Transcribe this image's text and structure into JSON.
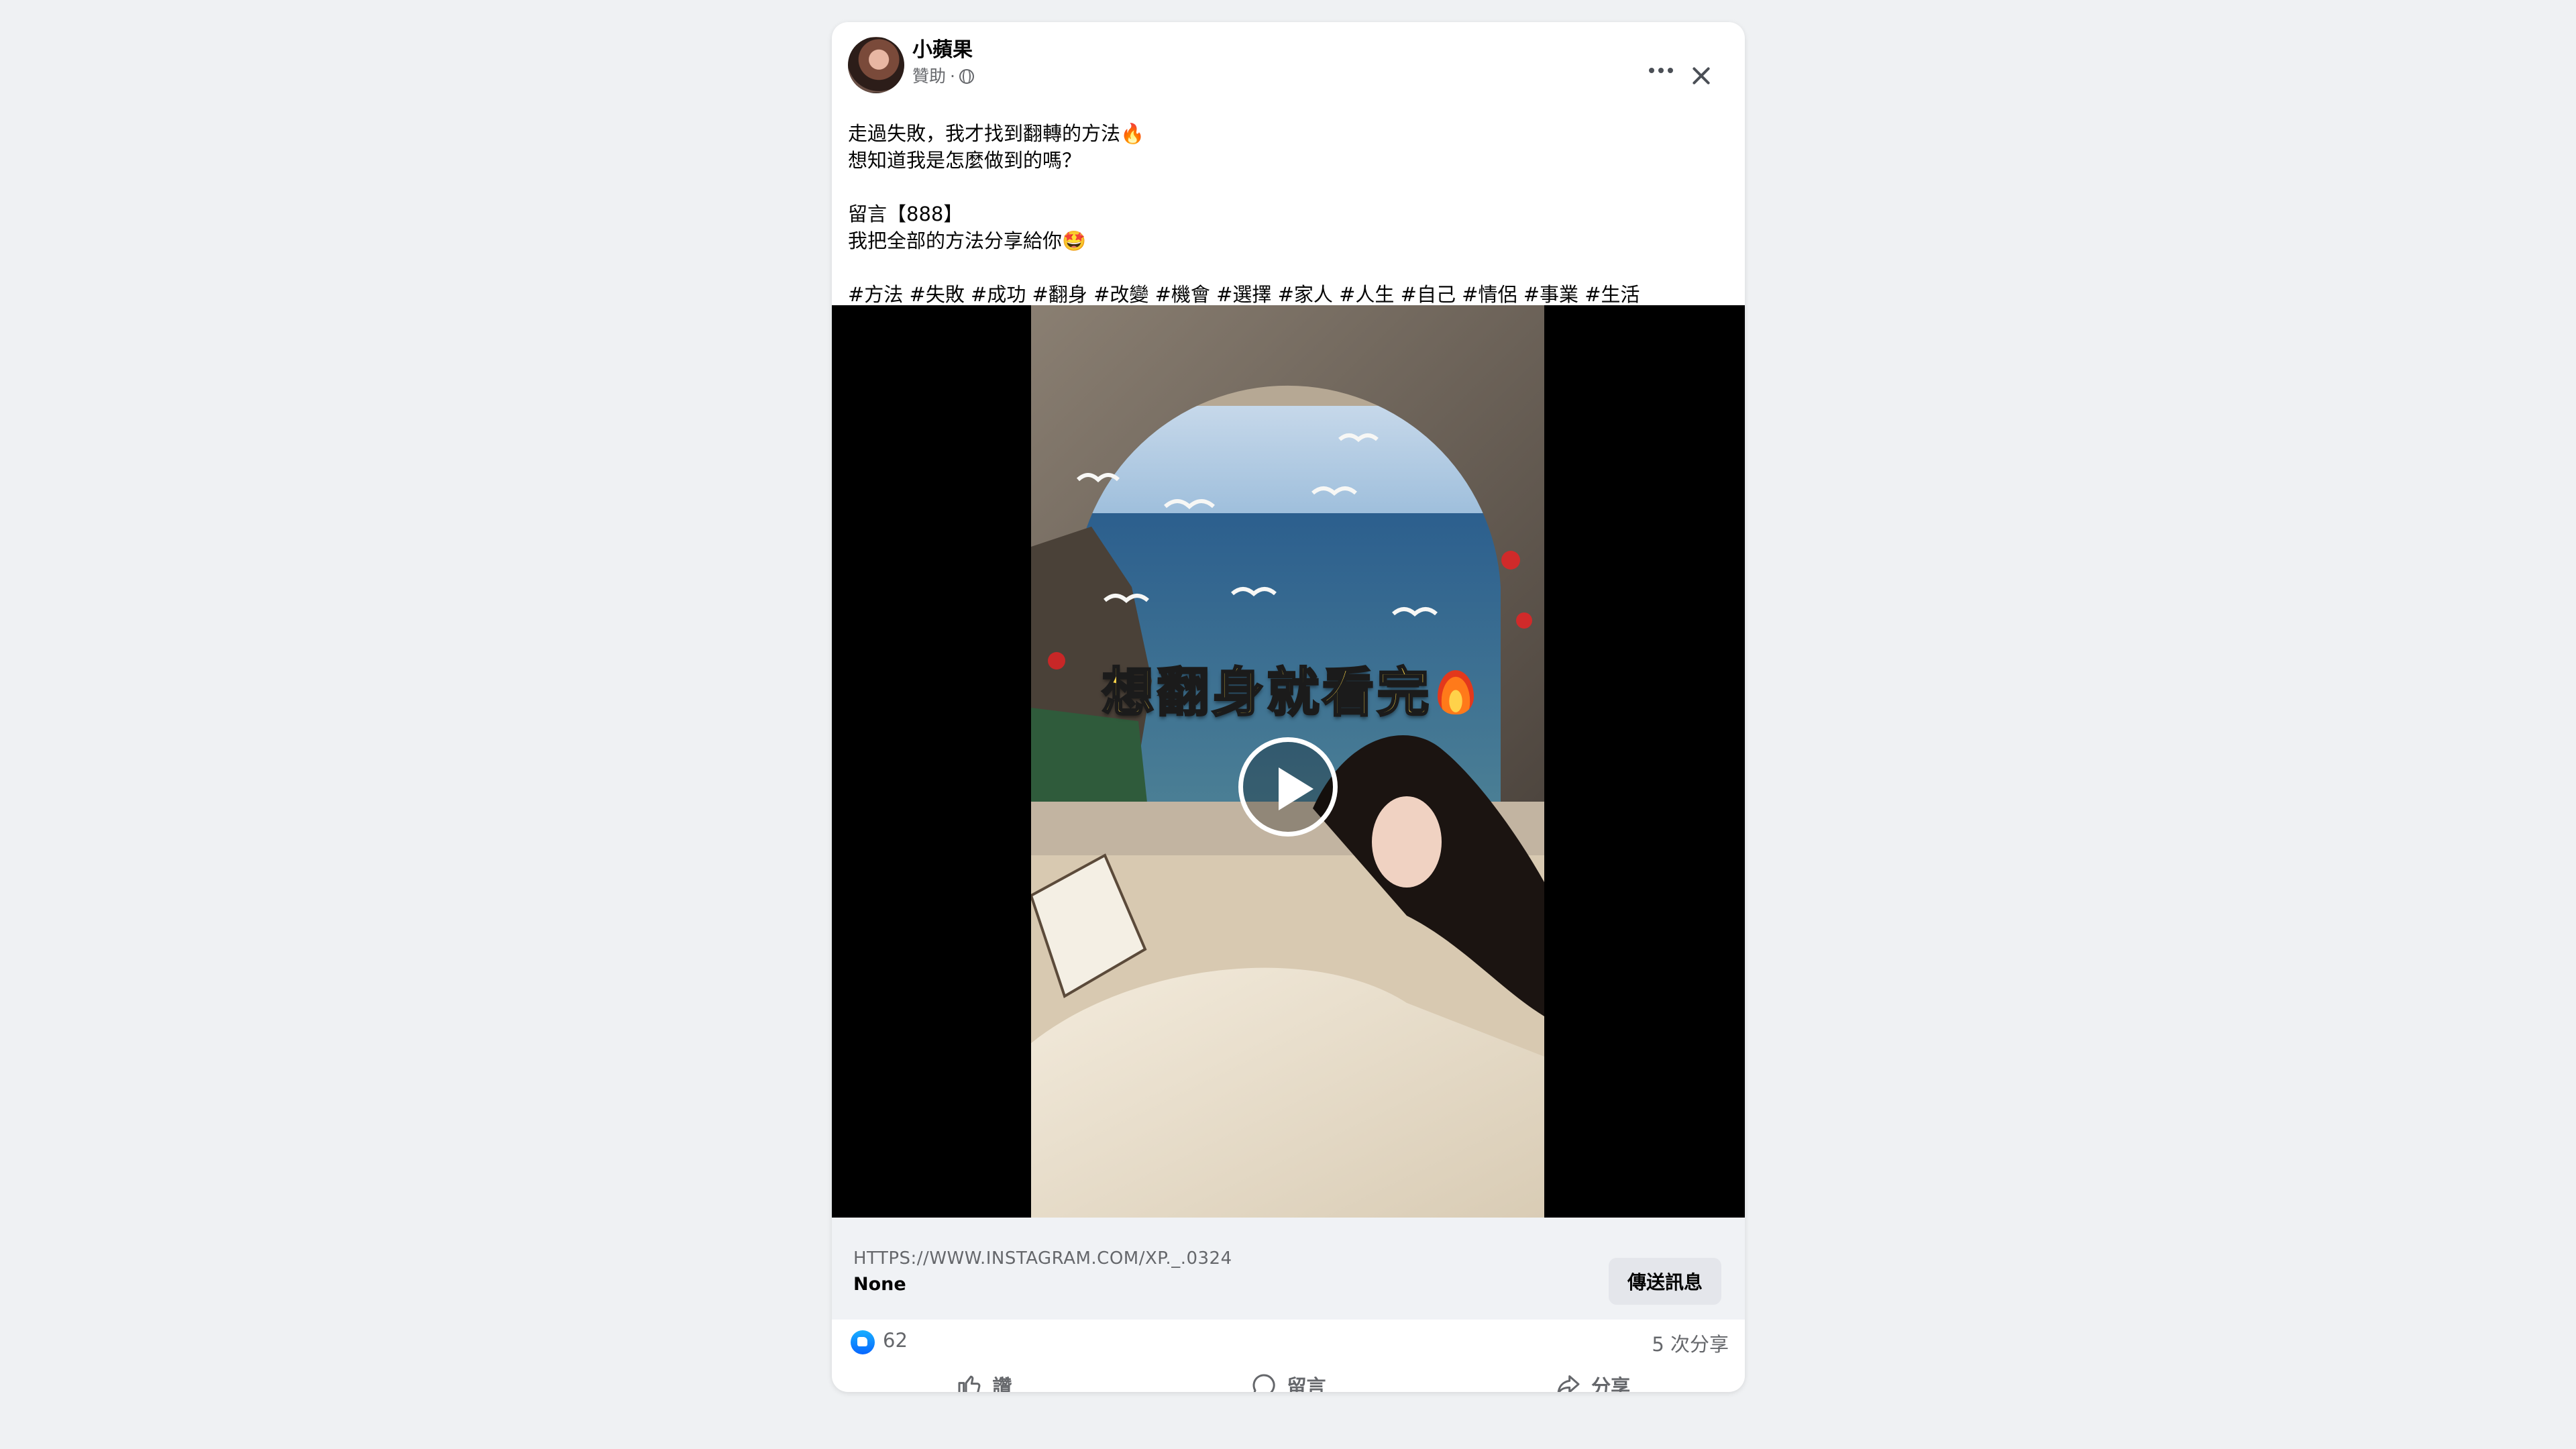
{
  "post": {
    "page_name": "小蘋果",
    "sponsored_label": "贊助",
    "meta_separator": "·",
    "text_lines": [
      "走過失敗，我才找到翻轉的方法🔥",
      "想知道我是怎麼做到的嗎？",
      "",
      "留言【888】",
      "我把全部的方法分享給你🤩",
      "",
      "#方法 #失敗 #成功 #翻身 #改變 #機會 #選擇 #家人 #人生 #自己 #情侶 #事業 #生活"
    ]
  },
  "video": {
    "overlay_text": "想翻身就看完"
  },
  "link": {
    "url": "HTTPS://WWW.INSTAGRAM.COM/XP._.0324",
    "title": "None",
    "button_label": "傳送訊息"
  },
  "stats": {
    "like_count": "62",
    "share_count": "5 次分享"
  },
  "actions": {
    "like": "讚",
    "comment": "留言",
    "share": "分享"
  },
  "icons": [
    "avatar",
    "globe-icon",
    "more-options-icon",
    "close-icon",
    "flame-icon",
    "play-icon",
    "like-reaction-icon",
    "thumbs-up-icon",
    "comment-icon",
    "share-icon"
  ],
  "colors": {
    "accent_blue": "#0866ff",
    "overlay_yellow": "#f7d34a",
    "background": "#eff1f3"
  }
}
